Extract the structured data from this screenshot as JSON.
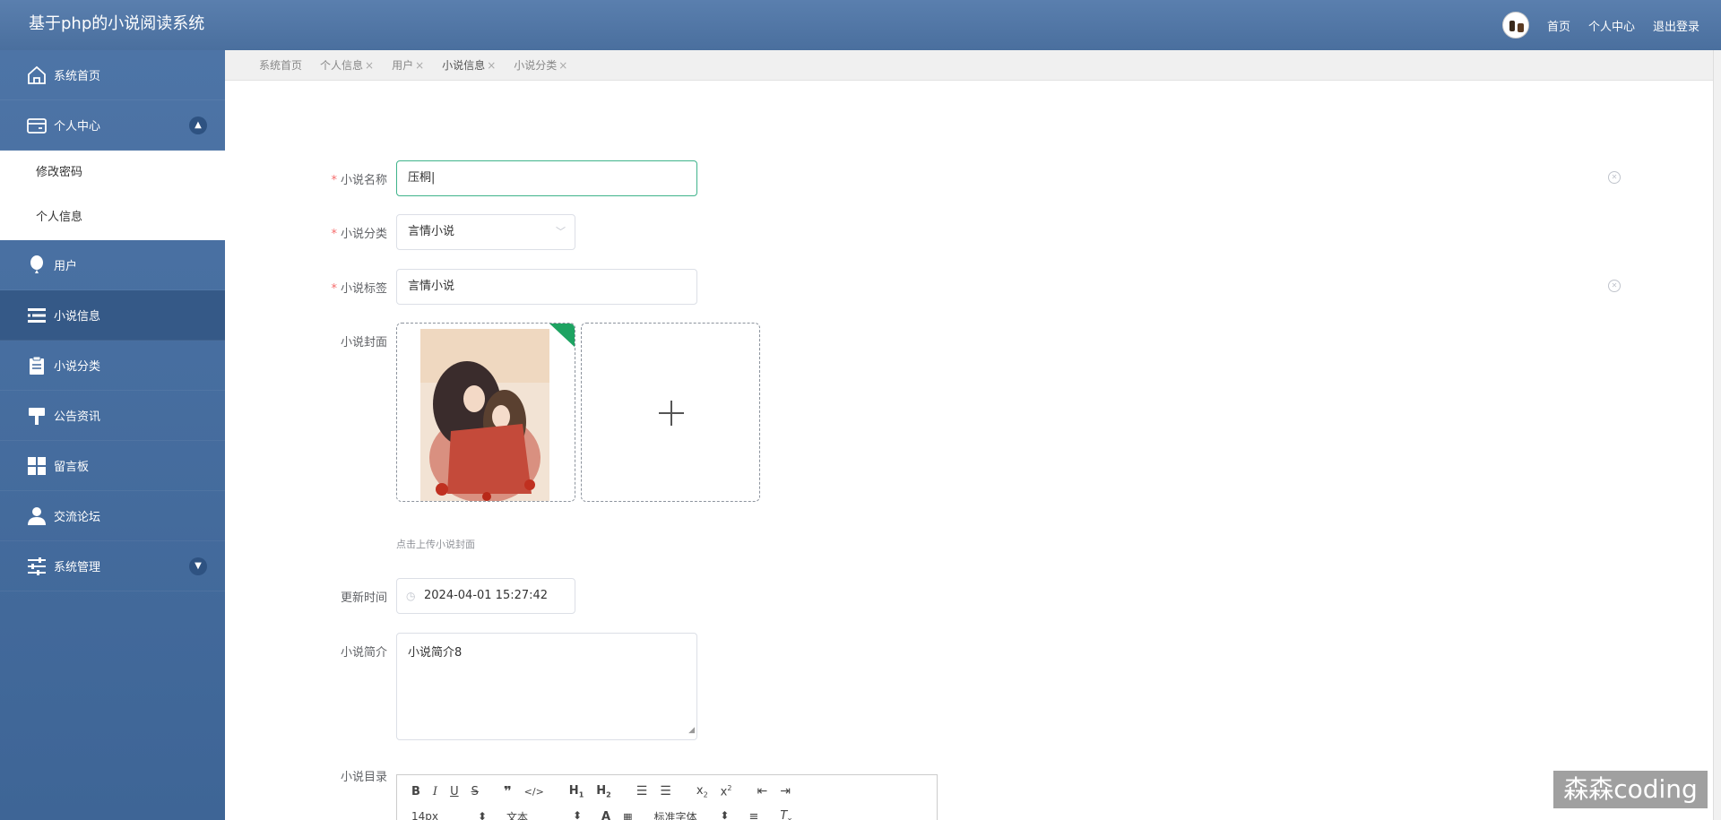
{
  "header": {
    "app_title": "基于php的小说阅读系统",
    "nav_home": "首页",
    "nav_profile": "个人中心",
    "nav_logout": "退出登录"
  },
  "sidebar": {
    "items": [
      {
        "label": "系统首页",
        "icon": "home-icon"
      },
      {
        "label": "个人中心",
        "icon": "wallet-icon",
        "expanded": true
      },
      {
        "label": "用户",
        "icon": "balloon-icon"
      },
      {
        "label": "小说信息",
        "icon": "list-icon",
        "active": true
      },
      {
        "label": "小说分类",
        "icon": "clipboard-icon"
      },
      {
        "label": "公告资讯",
        "icon": "paint-roller-icon"
      },
      {
        "label": "留言板",
        "icon": "grid-icon"
      },
      {
        "label": "交流论坛",
        "icon": "user-icon"
      },
      {
        "label": "系统管理",
        "icon": "sliders-icon",
        "expanded": false
      }
    ],
    "sub_items": [
      "修改密码",
      "个人信息"
    ]
  },
  "tabs": [
    {
      "label": "系统首页",
      "closable": false
    },
    {
      "label": "个人信息",
      "closable": true
    },
    {
      "label": "用户",
      "closable": true
    },
    {
      "label": "小说信息",
      "closable": true,
      "active": true
    },
    {
      "label": "小说分类",
      "closable": true
    }
  ],
  "tab_close_glyph": "×",
  "form": {
    "name_label": "小说名称",
    "name_value": "压桐",
    "category_label": "小说分类",
    "category_value": "言情小说",
    "tag_label": "小说标签",
    "tag_value": "言情小说",
    "cover_label": "小说封面",
    "cover_hint": "点击上传小说封面",
    "update_time_label": "更新时间",
    "update_time_value": "2024-04-01 15:27:42",
    "intro_label": "小说简介",
    "intro_value": "小说简介8",
    "catalog_label": "小说目录"
  },
  "editor": {
    "font_size": "14px",
    "paragraph": "文本",
    "font_family": "标准字体"
  },
  "watermark": "森森coding",
  "colors": {
    "sidebar": "#4a70a2",
    "active_menu": "#355987",
    "focus_border": "#3fb38b",
    "required": "#f56c6c"
  }
}
